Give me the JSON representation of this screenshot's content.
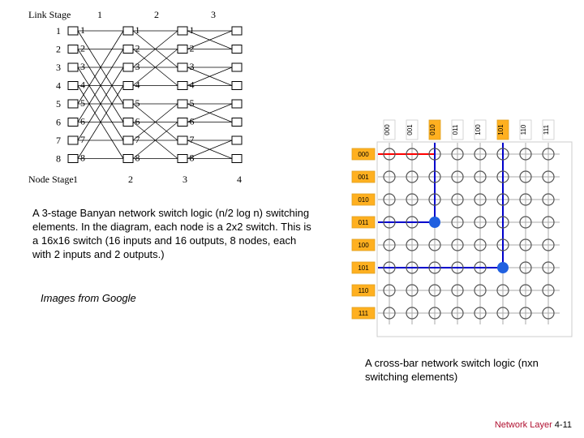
{
  "banyan": {
    "link_stage_label": "Link Stage",
    "node_stage_label": "Node Stage",
    "link_stages": [
      "1",
      "2",
      "3"
    ],
    "node_stages": [
      "1",
      "2",
      "3",
      "4"
    ],
    "row_numbers": [
      "1",
      "2",
      "3",
      "4",
      "5",
      "6",
      "7",
      "8"
    ],
    "inner_row_numbers": [
      "1",
      "2",
      "3",
      "4",
      "5",
      "6",
      "7",
      "8"
    ]
  },
  "crossbar": {
    "col_headers": [
      "000",
      "001",
      "010",
      "011",
      "100",
      "101",
      "110",
      "111"
    ],
    "row_labels": [
      "000",
      "001",
      "010",
      "011",
      "100",
      "101",
      "110",
      "111"
    ],
    "highlighted_col_headers": [
      "010",
      "101"
    ],
    "grid_size": 8,
    "red_path": {
      "row_index": 0,
      "col_index": 2
    },
    "blue_path_a": {
      "row_index": 3,
      "turn_col_index": 2
    },
    "blue_path_b": {
      "row_index": 5,
      "turn_col_index": 5
    }
  },
  "captions": {
    "banyan": "A 3-stage Banyan network switch logic (n/2 log n) switching elements. In the diagram, each node is a 2x2 switch. This is a 16x16 switch (16 inputs and 16 outputs, 8 nodes, each with 2 inputs and 2 outputs.)",
    "source": "Images from Google",
    "crossbar": "A cross-bar network switch logic (nxn switching elements)"
  },
  "footer": {
    "label": "Network Layer",
    "page": "4-11"
  },
  "chart_data": [
    {
      "type": "diagram",
      "name": "3-stage Banyan network",
      "stages": 3,
      "node_columns": 4,
      "rows": 8,
      "inputs": 16,
      "outputs": 16,
      "switch_type": "2x2",
      "complexity": "n/2 log n"
    },
    {
      "type": "diagram",
      "name": "Crossbar switch",
      "rows": 8,
      "cols": 8,
      "complexity": "n x n",
      "highlighted_paths": [
        {
          "color": "red",
          "from_row": "000",
          "to_col": "010"
        },
        {
          "color": "blue",
          "from_row": "011",
          "turn_col": "010"
        },
        {
          "color": "blue",
          "from_row": "101",
          "turn_col": "101"
        }
      ]
    }
  ]
}
